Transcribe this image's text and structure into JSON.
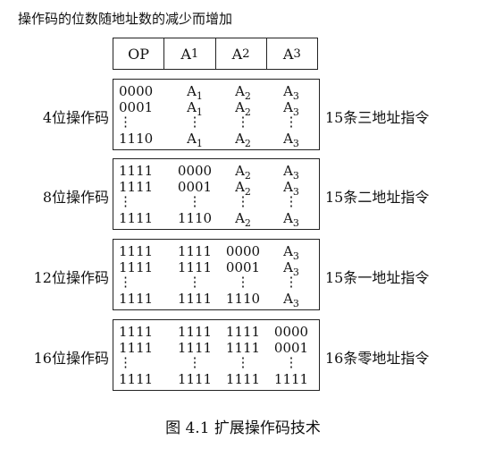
{
  "title": "操作码的位数随地址数的减少而增加",
  "header": [
    "OP",
    "A1",
    "A2",
    "A3"
  ],
  "groups": [
    {
      "left_label": "4位操作码",
      "right_label": "15条三地址指令",
      "rows": [
        [
          "0000",
          "A1",
          "A2",
          "A3"
        ],
        [
          "0001",
          "A1",
          "A2",
          "A3"
        ],
        [
          "⋮",
          "⋮",
          "⋮",
          "⋮"
        ],
        [
          "1110",
          "A1",
          "A2",
          "A3"
        ]
      ]
    },
    {
      "left_label": "8位操作码",
      "right_label": "15条二地址指令",
      "rows": [
        [
          "1111",
          "0000",
          "A2",
          "A3"
        ],
        [
          "1111",
          "0001",
          "A2",
          "A3"
        ],
        [
          "⋮",
          "⋮",
          "⋮",
          "⋮"
        ],
        [
          "1111",
          "1110",
          "A2",
          "A3"
        ]
      ]
    },
    {
      "left_label": "12位操作码",
      "right_label": "15条一地址指令",
      "rows": [
        [
          "1111",
          "1111",
          "0000",
          "A3"
        ],
        [
          "1111",
          "1111",
          "0001",
          "A3"
        ],
        [
          "⋮",
          "⋮",
          "⋮",
          "⋮"
        ],
        [
          "1111",
          "1111",
          "1110",
          "A3"
        ]
      ]
    },
    {
      "left_label": "16位操作码",
      "right_label": "16条零地址指令",
      "rows": [
        [
          "1111",
          "1111",
          "1111",
          "0000"
        ],
        [
          "1111",
          "1111",
          "1111",
          "0001"
        ],
        [
          "⋮",
          "⋮",
          "⋮",
          "⋮"
        ],
        [
          "1111",
          "1111",
          "1111",
          "1111"
        ]
      ]
    }
  ],
  "figure_caption": "图 4.1    扩展操作码技术"
}
